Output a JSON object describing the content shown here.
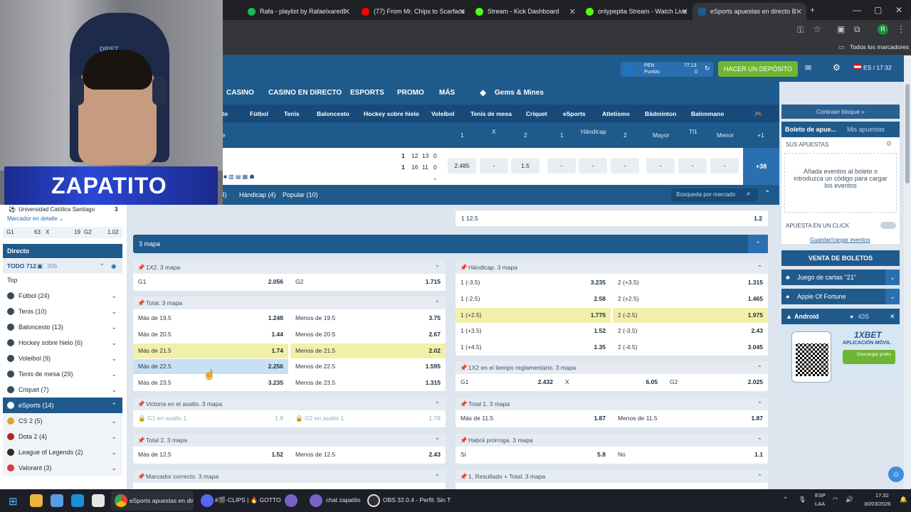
{
  "browser": {
    "tabs": [
      {
        "title": "Rafa - playlist by RafaelxaredI",
        "color": "#1db954"
      },
      {
        "title": "(77) From Mr. Chips to Scarface",
        "color": "#ff0000"
      },
      {
        "title": "Stream - Kick Dashboard",
        "color": "#53fc18"
      },
      {
        "title": "onlypepita Stream - Watch Live",
        "color": "#53fc18"
      },
      {
        "title": "eSports apuestas en directo B",
        "color": "#1f5a8c"
      }
    ],
    "bookmarks_label": "Todos los marcadores",
    "profile_initial": "R"
  },
  "header": {
    "currency": "PEN",
    "points_label": "Puntos",
    "balance": "77.13",
    "points": "0",
    "deposit_button": "HACER UN DEPÓSITO",
    "lang_time": "ES / 17:32"
  },
  "nav": {
    "items": [
      "CASINO",
      "CASINO EN DIRECTO",
      "ESPORTS",
      "PROMO",
      "MÁS"
    ],
    "gems": "Gems & Mines"
  },
  "sports": [
    "Fútbol",
    "Tenis",
    "Baloncesto",
    "Hockey sobre hielo",
    "Voleibol",
    "Tenis de mesa",
    "Criquet",
    "eSports",
    "Atletismo",
    "Bádminton",
    "Balonmano"
  ],
  "match_header": {
    "cols": [
      "1",
      "X",
      "2",
      "1",
      "Hándicap",
      "2",
      "Mayor",
      "Tl1",
      "Menor",
      "+1"
    ]
  },
  "match_row": {
    "score1": [
      "1",
      "12",
      "13",
      "0"
    ],
    "score2": [
      "1",
      "16",
      "11",
      "0"
    ],
    "odds": [
      "2.485",
      "-",
      "1.5",
      "-",
      "-",
      "-",
      "-",
      "-",
      "-"
    ],
    "more": "+38"
  },
  "filters": {
    "items": [
      "al (4)",
      "Hándicap (4)",
      "Popular (10)"
    ],
    "search_placeholder": "Búsqueda por mercado"
  },
  "top_row": {
    "label": "1 12.5",
    "value": "1.2"
  },
  "map3_title": "3 mapa",
  "markets_left": [
    {
      "title": "1X2. 3 mapa",
      "rows": [
        [
          {
            "l": "G1",
            "v": "2.056"
          },
          {
            "l": "G2",
            "v": "1.715"
          }
        ]
      ]
    },
    {
      "title": "Total. 3 mapa",
      "rows": [
        [
          {
            "l": "Más de 19.5",
            "v": "1.248"
          },
          {
            "l": "Menos de 19.5",
            "v": "3.75"
          }
        ],
        [
          {
            "l": "Más de 20.5",
            "v": "1.44"
          },
          {
            "l": "Menos de 20.5",
            "v": "2.67"
          }
        ],
        [
          {
            "l": "Más de 21.5",
            "v": "1.74"
          },
          {
            "l": "Menos de 21.5",
            "v": "2.02"
          }
        ],
        [
          {
            "l": "Más de 22.5",
            "v": "2.256"
          },
          {
            "l": "Menos de 22.5",
            "v": "1.595"
          }
        ],
        [
          {
            "l": "Más de 23.5",
            "v": "3.235"
          },
          {
            "l": "Menos de 23.5",
            "v": "1.315"
          }
        ]
      ]
    },
    {
      "title": "Victoria en el asalto. 3 mapa",
      "rows": [
        [
          {
            "l": "G1 en asalto 1",
            "v": "1.9"
          },
          {
            "l": "G2 en asalto 1",
            "v": "1.78"
          }
        ]
      ]
    },
    {
      "title": "Total 2. 3 mapa",
      "rows": [
        [
          {
            "l": "Más de 12.5",
            "v": "1.52"
          },
          {
            "l": "Menos de 12.5",
            "v": "2.43"
          }
        ]
      ]
    },
    {
      "title": "Marcador correcto. 3 mapa"
    }
  ],
  "markets_right": [
    {
      "title": "Hándicap. 3 mapa",
      "rows": [
        [
          {
            "l": "1 (-3.5)",
            "v": "3.235"
          },
          {
            "l": "2 (+3.5)",
            "v": "1.315"
          }
        ],
        [
          {
            "l": "1 (-2.5)",
            "v": "2.58"
          },
          {
            "l": "2 (+2.5)",
            "v": "1.465"
          }
        ],
        [
          {
            "l": "1 (+2.5)",
            "v": "1.775"
          },
          {
            "l": "2 (-2.5)",
            "v": "1.975"
          }
        ],
        [
          {
            "l": "1 (+3.5)",
            "v": "1.52"
          },
          {
            "l": "2 (-3.5)",
            "v": "2.43"
          }
        ],
        [
          {
            "l": "1 (+4.5)",
            "v": "1.35"
          },
          {
            "l": "2 (-4.5)",
            "v": "3.045"
          }
        ]
      ]
    },
    {
      "title": "1X2 en el tiempo reglamentario. 3 mapa",
      "rows": [
        [
          {
            "l": "G1",
            "v": "2.432"
          },
          {
            "l": "X",
            "v": "6.05"
          },
          {
            "l": "G2",
            "v": "2.025"
          }
        ]
      ]
    },
    {
      "title": "Total 1. 3 mapa",
      "rows": [
        [
          {
            "l": "Más de 11.5",
            "v": "1.87"
          },
          {
            "l": "Menos de 11.5",
            "v": "1.87"
          }
        ]
      ]
    },
    {
      "title": "Habrá prórroga. 3 mapa",
      "rows": [
        [
          {
            "l": "Sí",
            "v": "5.8"
          },
          {
            "l": "No",
            "v": "1.1"
          }
        ]
      ]
    },
    {
      "title": "1, Resultado + Total. 3 mapa"
    }
  ],
  "left_sidebar": {
    "team": "Universidad Católica Santiago",
    "team_score": "3",
    "detail_link": "Marcador en detalle",
    "mini_odds": [
      "G1",
      "63",
      "X",
      "19",
      "G2",
      "1.02"
    ],
    "directo": "Directo",
    "todo": "TODO 712",
    "todo_count": "305",
    "top": "Top",
    "sports": [
      "Fútbol (24)",
      "Tenis (10)",
      "Baloncesto (13)",
      "Hockey sobre hielo (6)",
      "Voleibol (9)",
      "Tenis de mesa (29)",
      "Criquet (7)",
      "eSports (14)"
    ],
    "esports_sub": [
      "CS 2 (5)",
      "Dota 2 (4)",
      "League of Legends (2)",
      "Valorant (3)"
    ]
  },
  "right_sidebar": {
    "collapse": "Contraer bloque »",
    "tab_active": "Boleto de apue...",
    "tab_other": "Mis apuestas",
    "your_bets": "SUS APUESTAS",
    "empty_msg": "Añada eventos al boleto o introduzca un código para cargar los eventos",
    "one_click": "APUESTA EN UN CLICK",
    "save_load": "Guardar/cargar eventos",
    "sell": "VENTA DE BOLETOS",
    "game1": "Juego de cartas \"21\"",
    "game2": "Apple Of Fortune",
    "android": "Android",
    "ios": "iOS",
    "app_brand": "1XBET",
    "app_label": "APLICACIÓN MÓVIL",
    "download": "Descargar gratis"
  },
  "webcam": {
    "overlay_name": "ZAPATITO",
    "chair_brand": "DRIFT"
  },
  "taskbar": {
    "items": [
      "eSports apuestas en dir",
      "#🎬-CLIPS | 🔥 GOTTO",
      "chat zapatito",
      "OBS 32.0.4 - Perfil: Sin T"
    ],
    "lang": "ESP",
    "lang2": "LAA",
    "time": "17:32",
    "date": "30/03/2026"
  }
}
